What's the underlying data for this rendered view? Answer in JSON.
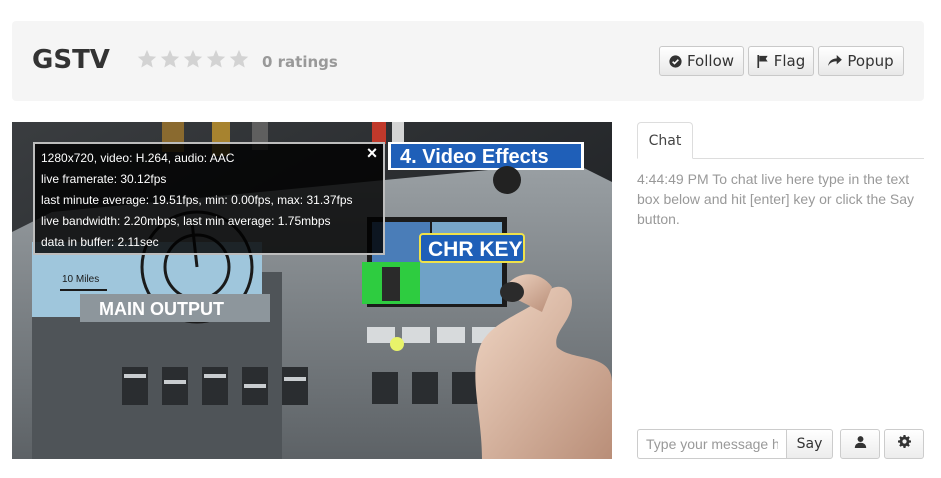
{
  "header": {
    "title": "GSTV",
    "rating": {
      "stars_filled": 0,
      "stars_total": 5,
      "label": "0 ratings"
    },
    "buttons": {
      "follow": "Follow",
      "flag": "Flag",
      "popup": "Popup"
    }
  },
  "video": {
    "overlay_title": "4. Video Effects",
    "overlay_key": "CHR KEY",
    "overlay_output": "MAIN OUTPUT",
    "overlay_scale": "10 Miles",
    "stats": {
      "lines": [
        "1280x720, video: H.264, audio: AAC",
        "live framerate: 30.12fps",
        "last minute average: 19.51fps, min: 0.00fps, max: 31.37fps",
        "live bandwidth: 2.20mbps, last min average: 1.75mbps",
        "data in buffer: 2.11sec"
      ],
      "close_glyph": "×"
    }
  },
  "chat": {
    "tab_label": "Chat",
    "message": "4:44:49 PM To chat live here type in the text box below and hit [enter] key or click the Say button.",
    "input_placeholder": "Type your message here",
    "say_label": "Say"
  },
  "colors": {
    "star_empty": "#d3d3d3",
    "header_bg": "#f5f5f5",
    "overlay_blue": "#1f5fb8"
  }
}
